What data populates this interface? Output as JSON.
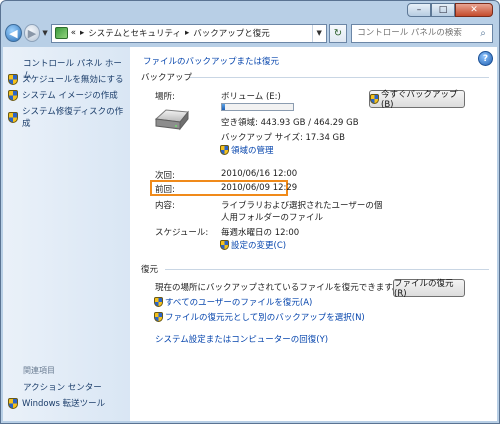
{
  "window": {
    "controls": {
      "minimize": "–",
      "maximize": "□",
      "close": "✕"
    }
  },
  "nav": {
    "address": {
      "chevron": "«",
      "crumbs": [
        "システムとセキュリティ",
        "バックアップと復元"
      ],
      "separator": "▸"
    },
    "search_placeholder": "コントロール パネルの検索"
  },
  "sidebar": {
    "home": "コントロール パネル ホーム",
    "items": [
      "スケジュールを無効にする",
      "システム イメージの作成",
      "システム修復ディスクの作成"
    ],
    "related_heading": "関連項目",
    "related": [
      "アクション センター",
      "Windows 転送ツール"
    ]
  },
  "main": {
    "title_link": "ファイルのバックアップまたは復元",
    "backup": {
      "heading": "バックアップ",
      "location_label": "場所:",
      "volume": "ボリューム (E:)",
      "free_space": "空き領域: 443.93 GB / 464.29 GB",
      "usage_fraction": 0.044,
      "size": "バックアップ サイズ: 17.34 GB",
      "manage_link": "領域の管理",
      "backup_now_button": "今すぐバックアップ(B)",
      "next_label": "次回:",
      "next_value": "2010/06/16 12:00",
      "last_label": "前回:",
      "last_value": "2010/06/09 12:29",
      "contents_label": "内容:",
      "contents_value_1": "ライブラリおよび選択されたユーザーの個",
      "contents_value_2": "人用フォルダーのファイル",
      "schedule_label": "スケジュール:",
      "schedule_value": "毎週水曜日の 12:00",
      "change_settings_link": "設定の変更(C)"
    },
    "restore": {
      "heading": "復元",
      "description": "現在の場所にバックアップされているファイルを復元できます。",
      "restore_button": "ファイルの復元(R)",
      "all_users_link": "すべてのユーザーのファイルを復元(A)",
      "select_other_link": "ファイルの復元元として別のバックアップを選択(N)",
      "recover_link": "システム設定またはコンピューターの回復(Y)"
    }
  },
  "colors": {
    "highlight": "#f08a1a",
    "link": "#0645ad"
  }
}
